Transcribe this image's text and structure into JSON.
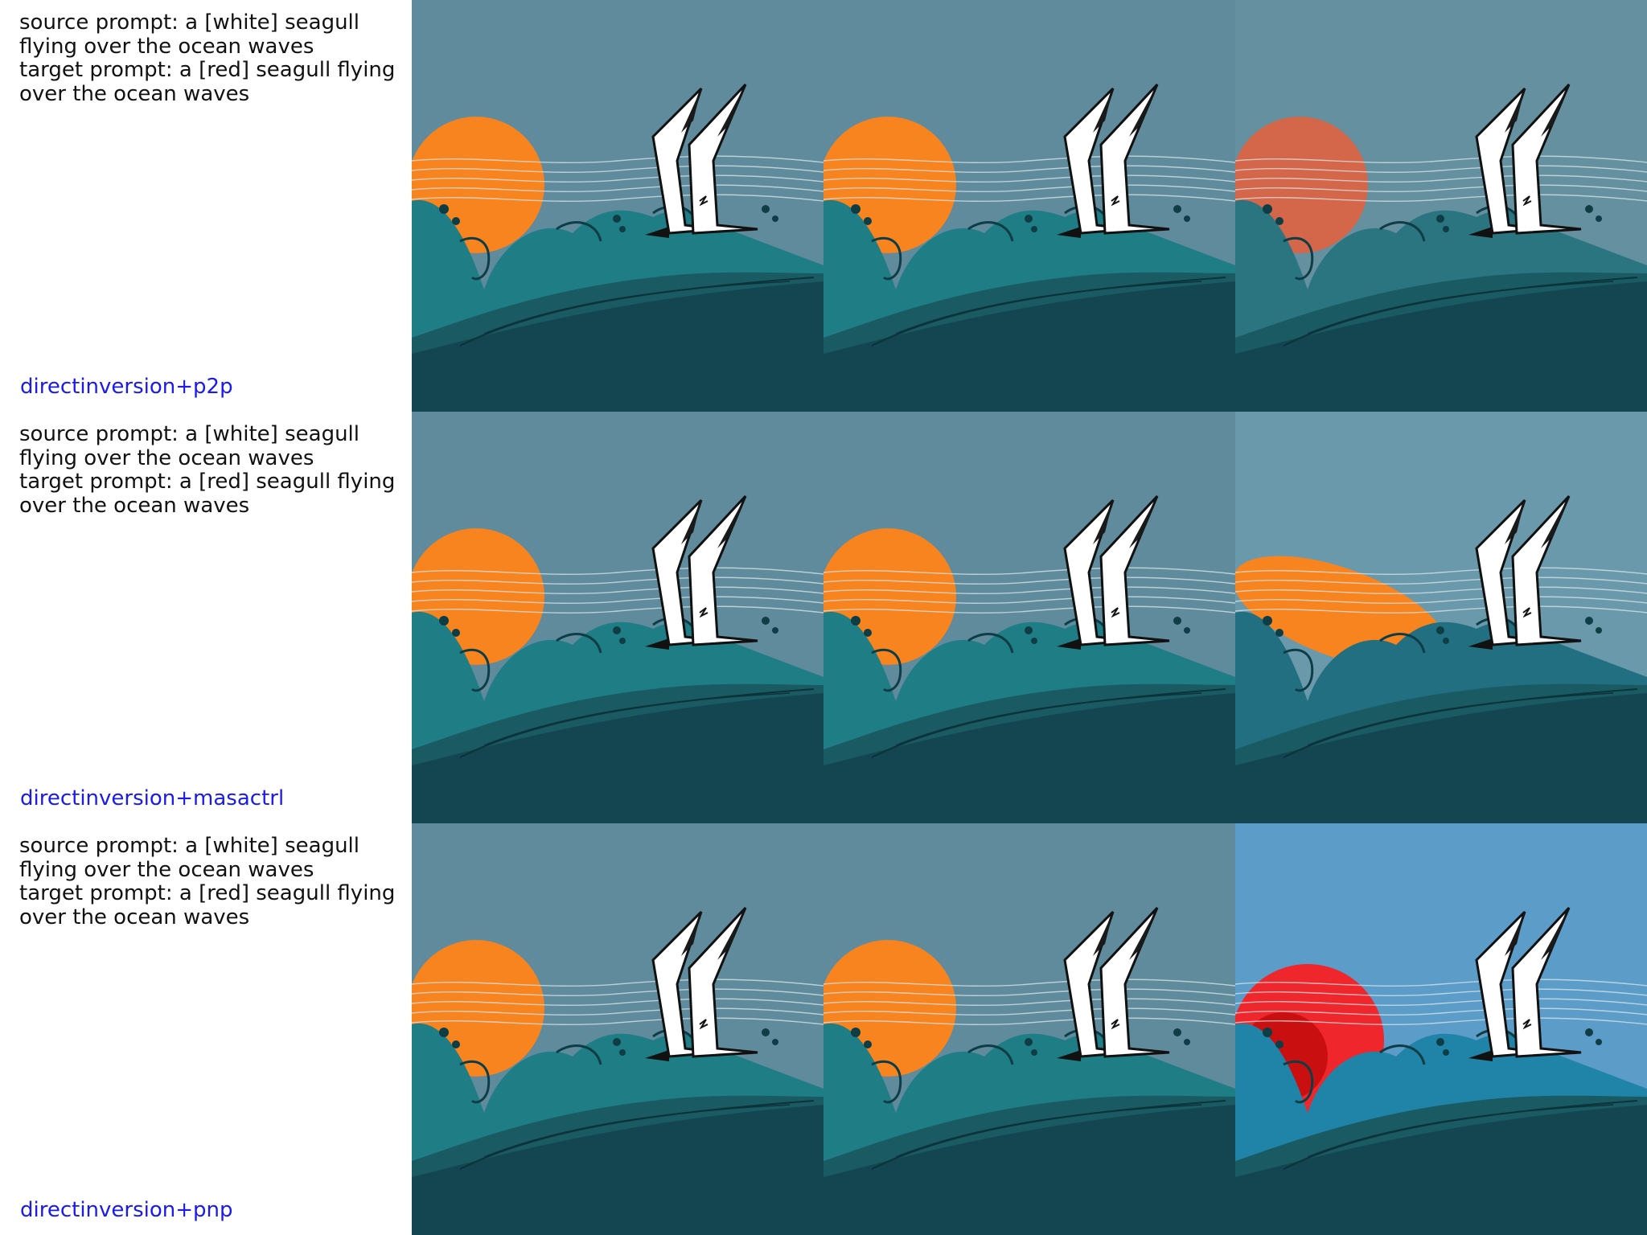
{
  "rows": [
    {
      "source_prompt": "source prompt: a [white] seagull flying over the ocean waves",
      "target_prompt": "target prompt: a [red] seagull flying over the ocean waves",
      "method": "directinversion+p2p"
    },
    {
      "source_prompt": "source prompt: a [white] seagull flying over the ocean waves",
      "target_prompt": "target prompt: a [red] seagull flying over the ocean waves",
      "method": "directinversion+masactrl"
    },
    {
      "source_prompt": "source prompt: a [white] seagull flying over the ocean waves",
      "target_prompt": "target prompt: a [red] seagull flying over the ocean waves",
      "method": "directinversion+pnp"
    }
  ],
  "colors": {
    "sky": "#5f8b9c",
    "sun": "#f7841f",
    "wave": "#1f7d85",
    "deep_sea": "#134650",
    "method_label": "#1a1aee"
  }
}
